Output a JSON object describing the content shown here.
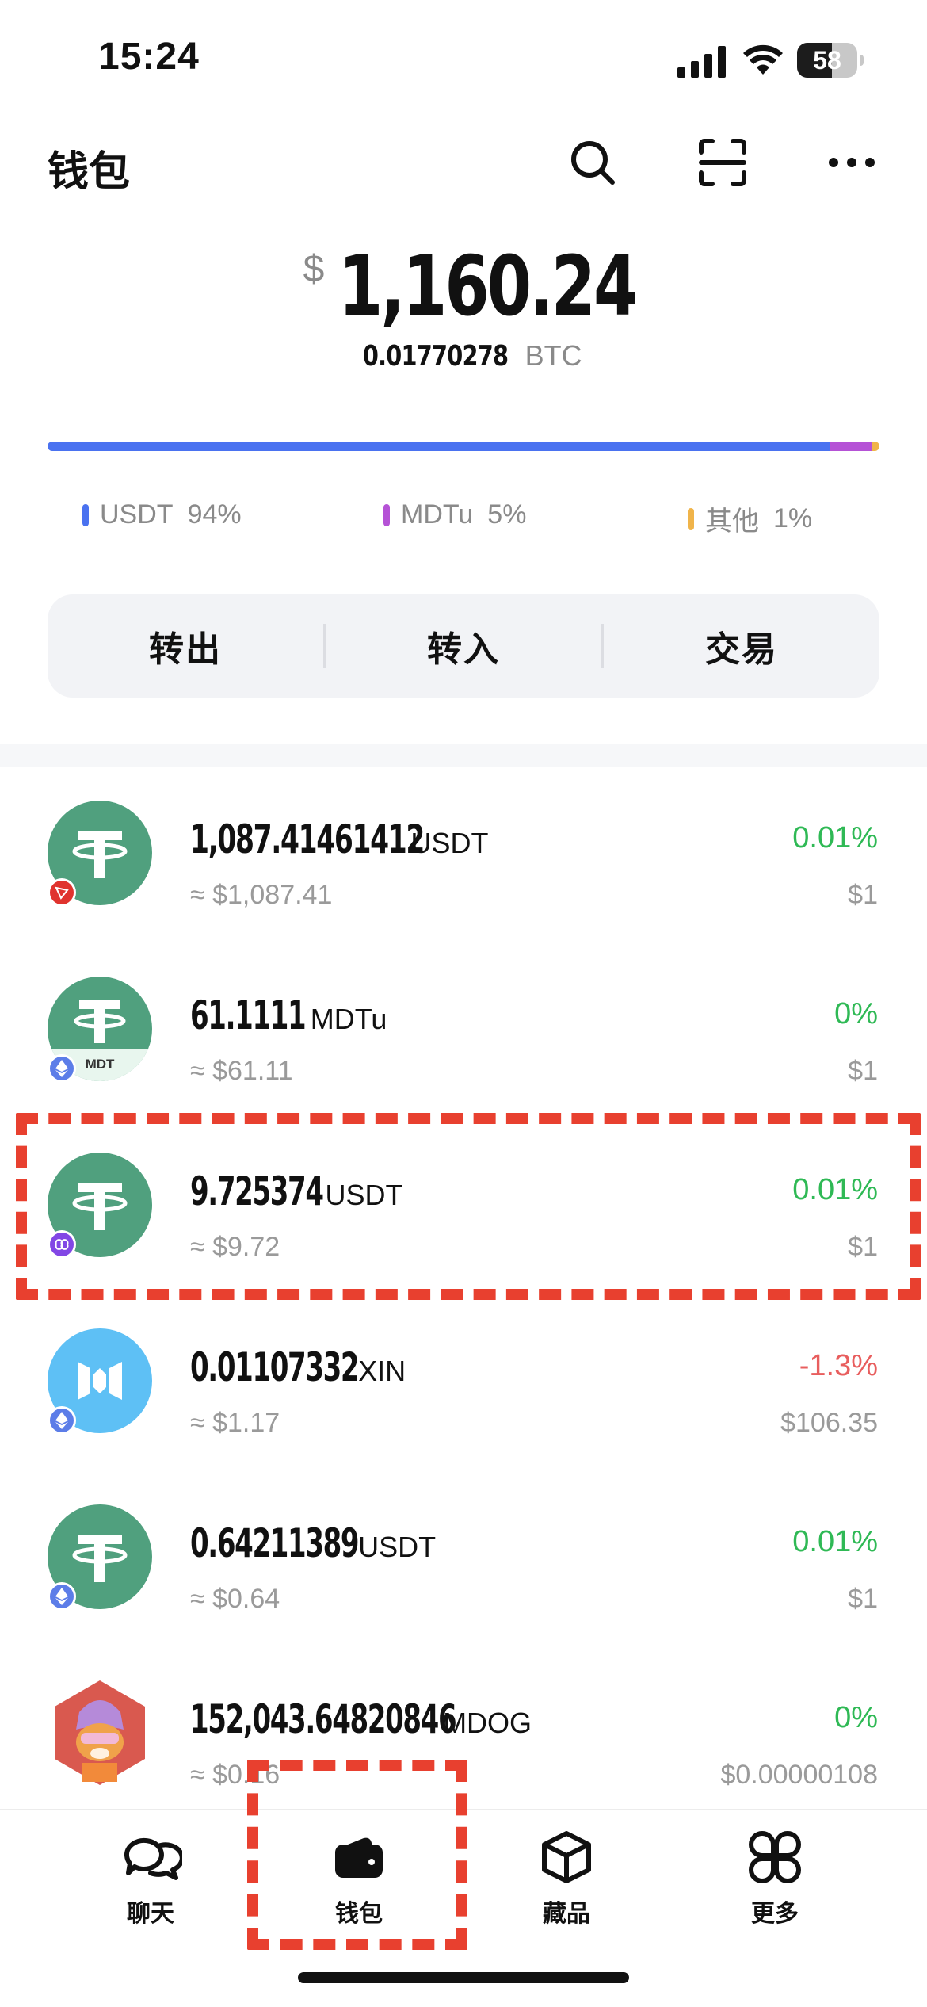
{
  "status_bar": {
    "time": "15:24",
    "battery_level": "58",
    "battery_fraction": 0.58,
    "icons": [
      "cellular-signal-icon",
      "wifi-icon",
      "battery-icon"
    ]
  },
  "header": {
    "title": "钱包",
    "icons": [
      "search-icon",
      "scan-icon",
      "more-icon"
    ]
  },
  "balance": {
    "currency_symbol": "$",
    "amount": "1,160.24",
    "btc_amount": "0.01770278",
    "btc_unit": "BTC"
  },
  "allocation": {
    "legend": [
      {
        "name": "USDT",
        "percent": "94%",
        "color": "#4a72f0"
      },
      {
        "name": "MDTu",
        "percent": "5%",
        "color": "#b552d6"
      },
      {
        "name": "其他",
        "percent": "1%",
        "color": "#f0b44a"
      }
    ],
    "fractions": [
      0.94,
      0.05,
      0.01
    ]
  },
  "actions": {
    "send": "转出",
    "receive": "转入",
    "trade": "交易"
  },
  "assets": [
    {
      "amount": "1,087.41461412",
      "symbol": "USDT",
      "usd_value": "≈ $1,087.41",
      "change": "0.01%",
      "direction": "up",
      "price": "$1",
      "icon": "tether-icon",
      "chain_badge": "tron-chain-badge-icon",
      "icon_color": "#50a07e",
      "badge_color": "#e0332e"
    },
    {
      "amount": "61.1111",
      "symbol": "MDTu",
      "usd_value": "≈ $61.11",
      "change": "0%",
      "direction": "up",
      "price": "$1",
      "icon": "tether-mdt-icon",
      "icon_label": "MDT",
      "chain_badge": "ethereum-chain-badge-icon",
      "icon_color": "#50a07e",
      "badge_color": "#5c7de8"
    },
    {
      "amount": "9.725374",
      "symbol": "USDT",
      "usd_value": "≈ $9.72",
      "change": "0.01%",
      "direction": "up",
      "price": "$1",
      "icon": "tether-icon",
      "chain_badge": "polygon-chain-badge-icon",
      "icon_color": "#50a07e",
      "badge_color": "#8247e5"
    },
    {
      "amount": "0.01107332",
      "symbol": "XIN",
      "usd_value": "≈ $1.17",
      "change": "-1.3%",
      "direction": "down",
      "price": "$106.35",
      "icon": "mixin-icon",
      "chain_badge": "ethereum-chain-badge-icon",
      "icon_color": "#5ec0f5",
      "badge_color": "#5c7de8"
    },
    {
      "amount": "0.64211389",
      "symbol": "USDT",
      "usd_value": "≈ $0.64",
      "change": "0.01%",
      "direction": "up",
      "price": "$1",
      "icon": "tether-icon",
      "chain_badge": "ethereum-chain-badge-icon",
      "icon_color": "#50a07e",
      "badge_color": "#5c7de8"
    },
    {
      "amount": "152,043.64820846",
      "symbol": "MDOG",
      "usd_value": "≈ $0.16",
      "change": "0%",
      "direction": "up",
      "price": "$0.00000108",
      "icon": "mdog-icon",
      "icon_color": "#d9594f"
    }
  ],
  "tab_bar": [
    {
      "label": "聊天",
      "icon": "chat-icon",
      "active": false
    },
    {
      "label": "钱包",
      "icon": "wallet-icon",
      "active": true
    },
    {
      "label": "藏品",
      "icon": "collectibles-icon",
      "active": false
    },
    {
      "label": "更多",
      "icon": "more-apps-icon",
      "active": false
    }
  ],
  "colors": {
    "up": "#2fb955",
    "down": "#e85e5e",
    "annotation": "#e8402f"
  }
}
